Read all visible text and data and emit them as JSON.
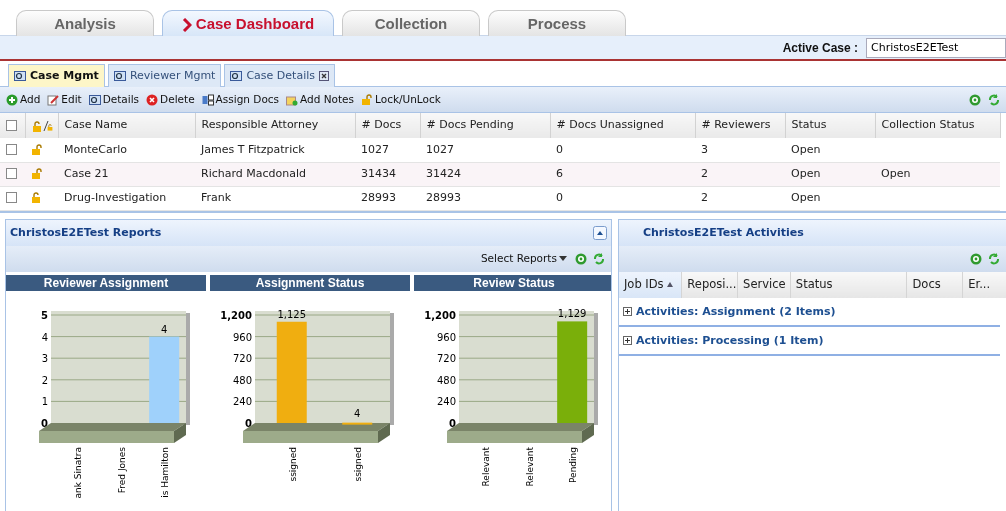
{
  "main_tabs": [
    {
      "label": "Analysis",
      "selected": false
    },
    {
      "label": "Case Dashboard",
      "selected": true
    },
    {
      "label": "Collection",
      "selected": false
    },
    {
      "label": "Process",
      "selected": false
    }
  ],
  "active_case": {
    "label": "Active Case :",
    "value": "ChristosE2ETest"
  },
  "sub_tabs": [
    {
      "label": "Case Mgmt",
      "selected": true,
      "closable": false
    },
    {
      "label": "Reviewer Mgmt",
      "selected": false,
      "closable": false
    },
    {
      "label": "Case Details",
      "selected": false,
      "closable": true
    }
  ],
  "toolbar": [
    "Add",
    "Edit",
    "Details",
    "Delete",
    "Assign Docs",
    "Add Notes",
    "Lock/UnLock"
  ],
  "cases_table": {
    "columns": [
      "Case Name",
      "Responsible Attorney",
      "# Docs",
      "# Docs Pending",
      "# Docs Unassigned",
      "# Reviewers",
      "Status",
      "Collection Status"
    ],
    "select_all_checked": false,
    "rows": [
      {
        "checked": false,
        "locked": false,
        "cells": [
          "MonteCarlo",
          "James T Fitzpatrick",
          "1027",
          "1027",
          "0",
          "3",
          "Open",
          ""
        ]
      },
      {
        "checked": false,
        "locked": false,
        "cells": [
          "Case 21",
          "Richard Macdonald",
          "31434",
          "31424",
          "6",
          "2",
          "Open",
          "Open"
        ]
      },
      {
        "checked": false,
        "locked": true,
        "cells": [
          "Drug-Investigation",
          "Frank",
          "28993",
          "28993",
          "0",
          "2",
          "Open",
          ""
        ]
      }
    ]
  },
  "reports_panel": {
    "title": "ChristosE2ETest Reports",
    "select_label": "Select Reports",
    "charts": [
      {
        "chart_data": {
          "type": "bar",
          "title": "Reviewer Assignment",
          "categories": [
            "ank Sinatra",
            "Fred Jones",
            "is Hamilton"
          ],
          "values": [
            0,
            0,
            4
          ],
          "grid": true,
          "ylim": [
            0,
            5
          ],
          "yticks": [
            0,
            1,
            2,
            3,
            4,
            5
          ],
          "value_labels": [
            null,
            null,
            "4"
          ],
          "color": "#9fd1fb"
        }
      },
      {
        "chart_data": {
          "type": "bar",
          "title": "Assignment Status",
          "categories": [
            "ssigned",
            "ssigned"
          ],
          "values": [
            1125,
            4
          ],
          "grid": true,
          "ylim": [
            0,
            1200
          ],
          "yticks": [
            0,
            240,
            480,
            720,
            960,
            {
              "value": 1200,
              "label": "1,200"
            }
          ],
          "value_labels": [
            "1,125",
            "4"
          ],
          "color": "#f0ae10"
        }
      },
      {
        "chart_data": {
          "type": "bar",
          "title": "Review Status",
          "categories": [
            "Relevant",
            "Relevant",
            "Pending"
          ],
          "values": [
            0,
            0,
            1129
          ],
          "grid": true,
          "ylim": [
            0,
            1200
          ],
          "yticks": [
            0,
            240,
            480,
            720,
            960,
            {
              "value": 1200,
              "label": "1,200"
            }
          ],
          "value_labels": [
            null,
            null,
            "1,129"
          ],
          "color": "#7aaf0a"
        }
      }
    ]
  },
  "activities_panel": {
    "title": "ChristosE2ETest Activities",
    "columns": [
      {
        "label": "Job IDs",
        "sorted": true
      },
      {
        "label": "Reposi...",
        "sorted": false
      },
      {
        "label": "Service",
        "sorted": false
      },
      {
        "label": "Status",
        "sorted": false
      },
      {
        "label": "Docs",
        "sorted": false
      },
      {
        "label": "Er...",
        "sorted": false
      }
    ],
    "groups": [
      {
        "label": "Activities: Assignment (2 Items)",
        "expanded": false
      },
      {
        "label": "Activities: Processing (1 Item)",
        "expanded": false
      }
    ]
  }
}
